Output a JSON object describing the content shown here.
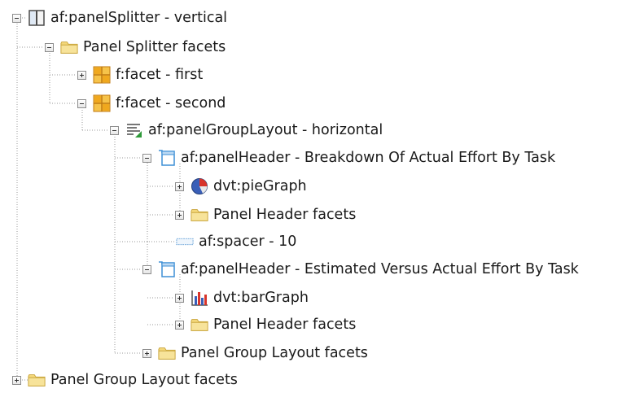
{
  "tree": {
    "nodes": [
      {
        "label": "af:panelSplitter - vertical",
        "icon": "panel-splitter-icon",
        "expander": "minus"
      },
      {
        "label": "Panel Splitter facets",
        "icon": "folder-icon",
        "expander": "minus"
      },
      {
        "label": "f:facet - first",
        "icon": "facet-grid-icon",
        "expander": "plus"
      },
      {
        "label": "f:facet - second",
        "icon": "facet-grid-icon",
        "expander": "minus"
      },
      {
        "label": "af:panelGroupLayout - horizontal",
        "icon": "panel-group-layout-icon",
        "expander": "minus"
      },
      {
        "label": "af:panelHeader - Breakdown Of Actual Effort By Task",
        "icon": "panel-header-icon",
        "expander": "minus"
      },
      {
        "label": "dvt:pieGraph",
        "icon": "pie-graph-icon",
        "expander": "plus"
      },
      {
        "label": "Panel Header facets",
        "icon": "folder-icon",
        "expander": "plus"
      },
      {
        "label": "af:spacer - 10",
        "icon": "spacer-icon",
        "expander": "none"
      },
      {
        "label": "af:panelHeader - Estimated Versus Actual Effort By Task",
        "icon": "panel-header-icon",
        "expander": "minus"
      },
      {
        "label": "dvt:barGraph",
        "icon": "bar-graph-icon",
        "expander": "plus"
      },
      {
        "label": "Panel Header facets",
        "icon": "folder-icon",
        "expander": "plus"
      },
      {
        "label": "Panel Group Layout facets",
        "icon": "folder-icon",
        "expander": "plus"
      },
      {
        "label": "Panel Group Layout facets",
        "icon": "folder-icon",
        "expander": "plus"
      }
    ]
  },
  "colors": {
    "guide_line": "#9a9a9a",
    "folder_fill": "#f3d77a",
    "folder_edge": "#c9a43a",
    "facet_orange": "#f0a81e",
    "panel_blue": "#3d8fd6"
  }
}
